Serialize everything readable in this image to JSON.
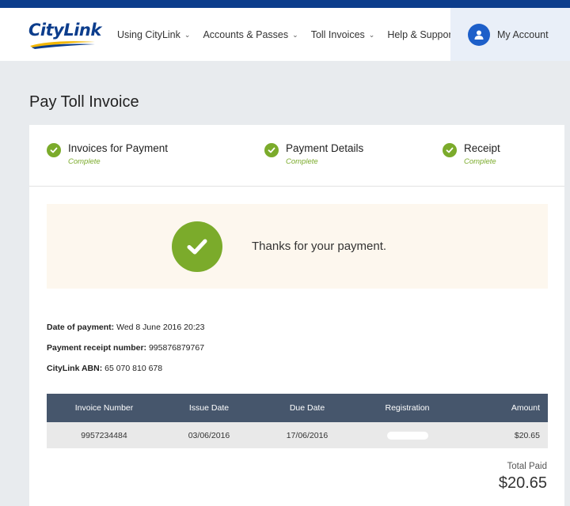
{
  "brand": {
    "logo_text": "CityLink",
    "primary": "#0c3d8c",
    "success": "#7bab2b",
    "table_header": "#46566c"
  },
  "nav": {
    "items": [
      {
        "label": "Using CityLink",
        "has_dropdown": true
      },
      {
        "label": "Accounts & Passes",
        "has_dropdown": true
      },
      {
        "label": "Toll Invoices",
        "has_dropdown": true
      },
      {
        "label": "Help & Support",
        "has_dropdown": false
      }
    ],
    "account_label": "My Account",
    "account_icon": "user-icon"
  },
  "page": {
    "title": "Pay Toll Invoice"
  },
  "steps": [
    {
      "title": "Invoices for Payment",
      "status": "Complete"
    },
    {
      "title": "Payment Details",
      "status": "Complete"
    },
    {
      "title": "Receipt",
      "status": "Complete"
    }
  ],
  "confirmation": {
    "message": "Thanks for your payment.",
    "icon": "check-icon"
  },
  "details": {
    "date_label": "Date of payment:",
    "date_value": "Wed 8 June 2016 20:23",
    "receipt_label": "Payment receipt number:",
    "receipt_value": "995876879767",
    "abn_label": "CityLink ABN:",
    "abn_value": "65 070 810 678"
  },
  "table": {
    "headers": [
      "Invoice Number",
      "Issue Date",
      "Due Date",
      "Registration",
      "Amount"
    ],
    "rows": [
      {
        "invoice_number": "9957234484",
        "issue_date": "03/06/2016",
        "due_date": "17/06/2016",
        "registration": "",
        "amount": "$20.65"
      }
    ]
  },
  "total": {
    "label": "Total Paid",
    "value": "$20.65"
  }
}
